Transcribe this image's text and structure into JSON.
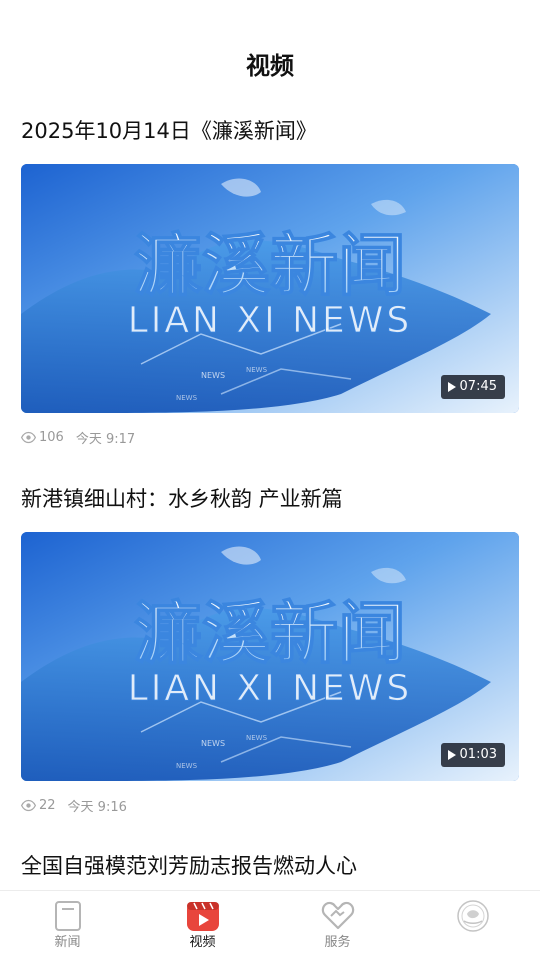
{
  "header": {
    "title": "视频"
  },
  "feed": {
    "items": [
      {
        "title": "2025年10月14日《濂溪新闻》",
        "duration": "07:45",
        "views": "106",
        "time": "今天 9:17",
        "thumb": {
          "cn": "濂溪新闻",
          "en": "LIAN XI NEWS",
          "tag": "NEWS"
        }
      },
      {
        "title": "新港镇细山村：水乡秋韵 产业新篇",
        "duration": "01:03",
        "views": "22",
        "time": "今天 9:16",
        "thumb": {
          "cn": "濂溪新闻",
          "en": "LIAN XI NEWS",
          "tag": "NEWS"
        }
      },
      {
        "title": "全国自强模范刘芳励志报告燃动人心"
      }
    ]
  },
  "tabbar": {
    "items": [
      {
        "label": "新闻",
        "icon": "news-icon",
        "active": false
      },
      {
        "label": "视频",
        "icon": "video-icon",
        "active": true
      },
      {
        "label": "服务",
        "icon": "handshake-icon",
        "active": false
      },
      {
        "label": "",
        "icon": "logo-icon",
        "active": false
      }
    ]
  },
  "colors": {
    "accent": "#e8453c",
    "thumb_blue": "#2a73d8",
    "meta_gray": "#999999"
  }
}
